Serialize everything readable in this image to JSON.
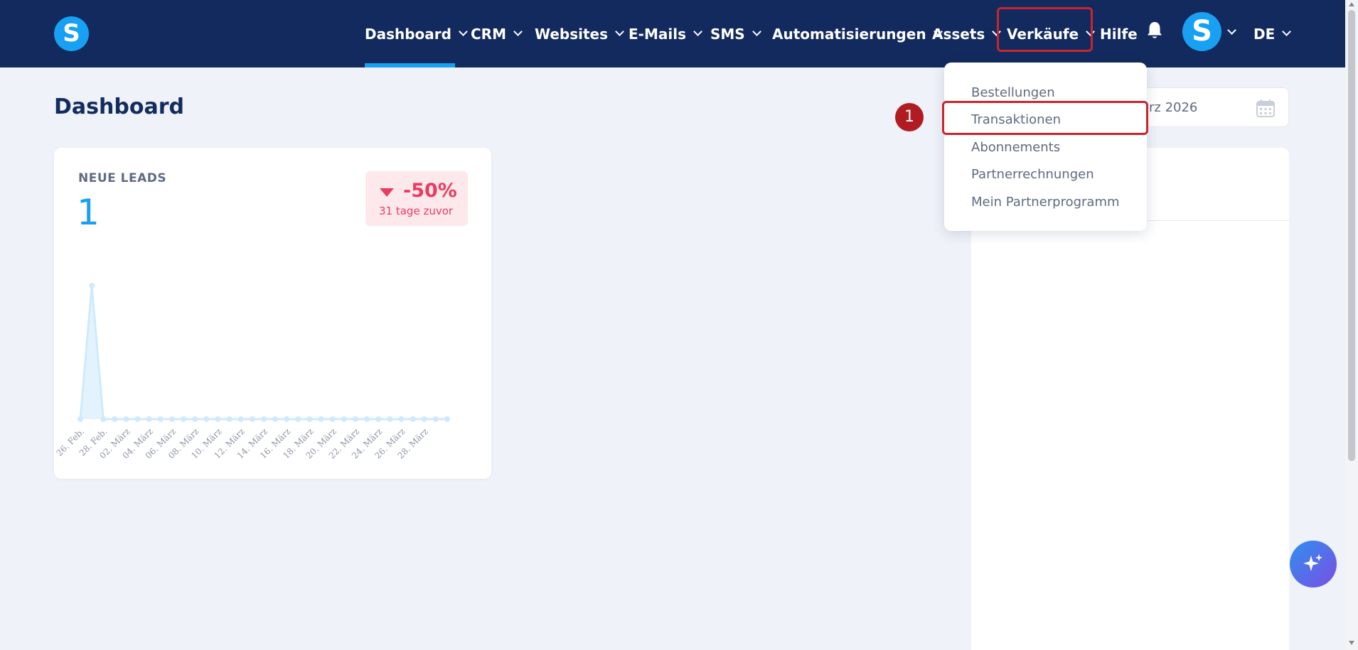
{
  "brand": {
    "logo_letter": "S"
  },
  "nav": {
    "items": [
      {
        "label": "Dashboard"
      },
      {
        "label": "CRM"
      },
      {
        "label": "Websites"
      },
      {
        "label": "E-Mails"
      },
      {
        "label": "SMS"
      },
      {
        "label": "Automatisierungen"
      },
      {
        "label": "Assets"
      },
      {
        "label": "Verkäufe"
      },
      {
        "label": "Hilfe"
      }
    ],
    "avatar_letter": "S",
    "language": "DE",
    "bell_icon": "bell-icon"
  },
  "page": {
    "title": "Dashboard",
    "date_range_text": "rz 2026",
    "calendar_icon": "calendar-icon"
  },
  "leads_card": {
    "label": "NEUE LEADS",
    "value": "1",
    "trend_value": "-50%",
    "trend_caption": "31 tage zuvor",
    "trend_color": "#e83d62"
  },
  "sales_menu": {
    "items": [
      {
        "label": "Bestellungen"
      },
      {
        "label": "Transaktionen"
      },
      {
        "label": "Abonnements"
      },
      {
        "label": "Partnerrechnungen"
      },
      {
        "label": "Mein Partnerprogramm"
      }
    ]
  },
  "annotation": {
    "step": "1"
  },
  "colors": {
    "nav_bg": "#122a5e",
    "accent": "#18a0f2",
    "highlight": "#c8262d",
    "badge": "#b01c22"
  },
  "chart_data": {
    "type": "area",
    "title": "",
    "xlabel": "",
    "ylabel": "",
    "ylim": [
      0,
      1
    ],
    "grid": false,
    "x": [
      "26. Feb.",
      "27. Feb.",
      "28. Feb.",
      "01. März",
      "02. März",
      "03. März",
      "04. März",
      "05. März",
      "06. März",
      "07. März",
      "08. März",
      "09. März",
      "10. März",
      "11. März",
      "12. März",
      "13. März",
      "14. März",
      "15. März",
      "16. März",
      "17. März",
      "18. März",
      "19. März",
      "20. März",
      "21. März",
      "22. März",
      "23. März",
      "24. März",
      "25. März",
      "26. März",
      "27. März",
      "28. März",
      "29. März",
      "30. März"
    ],
    "x_tick_labels": [
      "26. Feb.",
      "28. Feb.",
      "02. März",
      "04. März",
      "06. März",
      "08. März",
      "10. März",
      "12. März",
      "14. März",
      "16. März",
      "18. März",
      "20. März",
      "22. März",
      "24. März",
      "26. März",
      "28. März"
    ],
    "series": [
      {
        "values": [
          0,
          1,
          0,
          0,
          0,
          0,
          0,
          0,
          0,
          0,
          0,
          0,
          0,
          0,
          0,
          0,
          0,
          0,
          0,
          0,
          0,
          0,
          0,
          0,
          0,
          0,
          0,
          0,
          0,
          0,
          0,
          0,
          0
        ]
      }
    ]
  }
}
